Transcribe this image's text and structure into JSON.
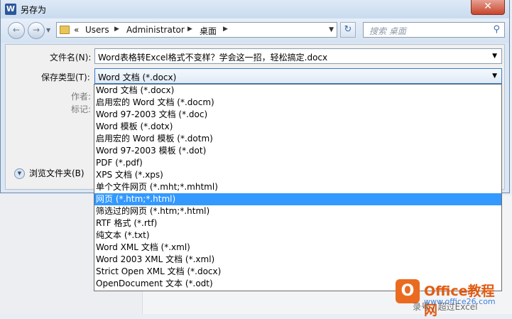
{
  "window": {
    "title": "另存为",
    "app_icon": "W",
    "close_glyph": "✕"
  },
  "nav": {
    "back_glyph": "←",
    "forward_glyph": "→",
    "history_glyph": "▼",
    "addr_prefix": "«",
    "crumbs": [
      "Users",
      "Administrator",
      "桌面"
    ],
    "sep_glyph": "▶",
    "addr_drop_glyph": "▼",
    "refresh_glyph": "↻",
    "search_placeholder": "搜索 桌面",
    "search_glyph": "⚲"
  },
  "form": {
    "filename_label": "文件名(N):",
    "filename_value": "Word表格转Excel格式不变样？学会这一招，轻松搞定.docx",
    "type_label": "保存类型(T):",
    "type_value": "Word 文档 (*.docx)",
    "author_label": "作者:",
    "tags_label": "标记:",
    "dropdown_arrow": "▼",
    "browse_toggle": "▼",
    "browse_label": "浏览文件夹(B)"
  },
  "dropdown": {
    "options": [
      "Word 文档 (*.docx)",
      "启用宏的 Word 文档 (*.docm)",
      "Word 97-2003 文档 (*.doc)",
      "Word 模板 (*.dotx)",
      "启用宏的 Word 模板 (*.dotm)",
      "Word 97-2003 模板 (*.dot)",
      "PDF (*.pdf)",
      "XPS 文档 (*.xps)",
      "单个文件网页 (*.mht;*.mhtml)",
      "网页 (*.htm;*.html)",
      "筛选过的网页 (*.htm;*.html)",
      "RTF 格式 (*.rtf)",
      "纯文本 (*.txt)",
      "Word XML 文档 (*.xml)",
      "Word 2003 XML 文档 (*.xml)",
      "Strict Open XML 文档 (*.docx)",
      "OpenDocument 文本 (*.odt)"
    ],
    "selected_index": 9,
    "highlight_color": "#3399ff"
  },
  "watermark": {
    "logo": "O",
    "brand": "Office教程网",
    "url": "www.office26.com",
    "overlay": "录号 / 超过Excel"
  }
}
